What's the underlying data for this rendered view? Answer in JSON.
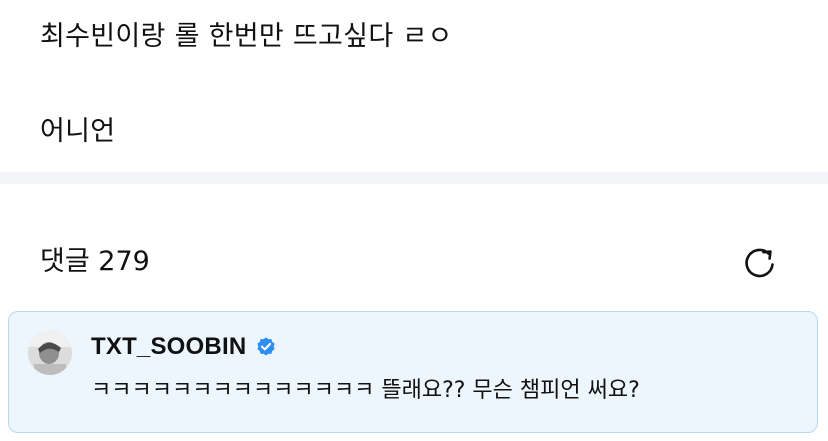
{
  "post": {
    "line1": "최수빈이랑 롤 한번만 뜨고싶다 ㄹㅇ",
    "line2": "어니언"
  },
  "comments": {
    "count_label": "댓글 279",
    "refresh_icon": "refresh-icon"
  },
  "pinned_comment": {
    "author": "TXT_SOOBIN",
    "verified_icon": "verified-badge-icon",
    "text": "ㅋㅋㅋㅋㅋㅋㅋㅋㅋㅋㅋㅋㅋㅋ 뜰래요?? 무슨 챔피언 써요?",
    "colors": {
      "background": "#eef6fd",
      "border": "#b9d9f2",
      "verified": "#2f8ef4"
    }
  }
}
